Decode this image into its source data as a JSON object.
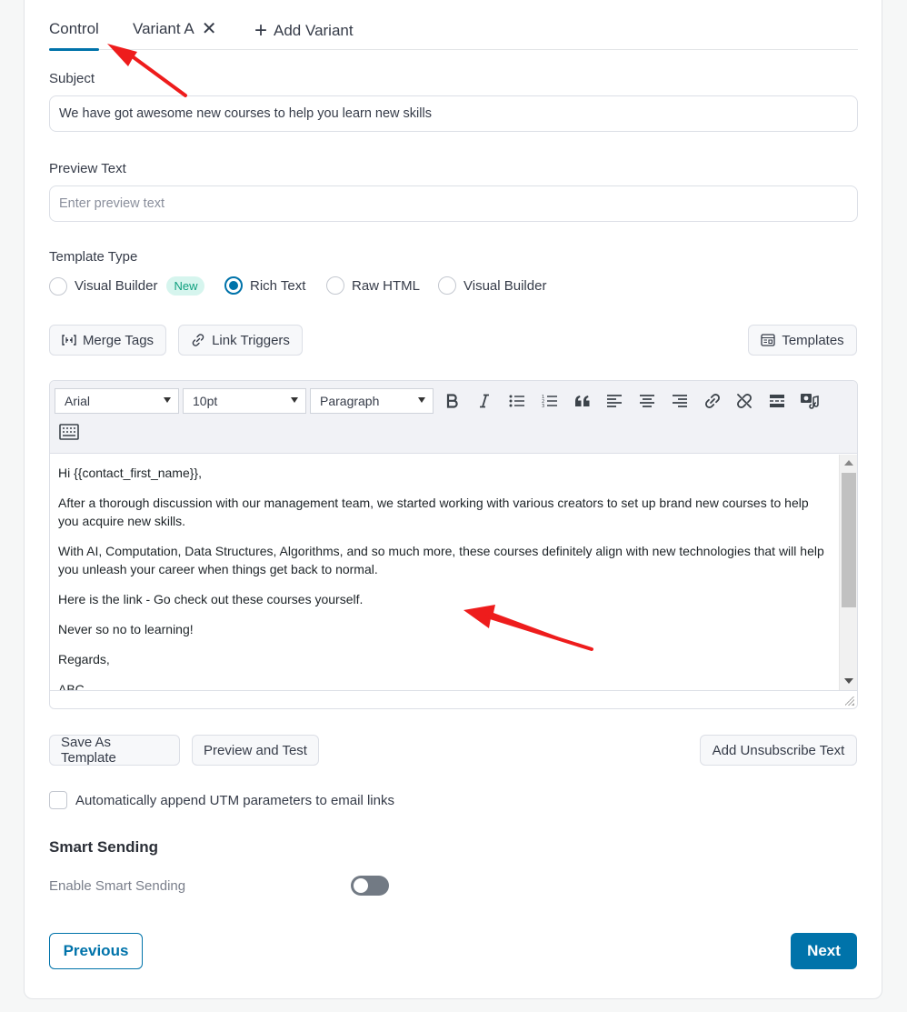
{
  "tabs": {
    "control": "Control",
    "variant_a": "Variant A",
    "add_variant": "Add Variant"
  },
  "subject": {
    "label": "Subject",
    "value": "We have got awesome new courses to help you learn new skills"
  },
  "preview_text": {
    "label": "Preview Text",
    "placeholder": "Enter preview text"
  },
  "template_type": {
    "label": "Template Type",
    "options": [
      "Visual Builder",
      "Rich Text",
      "Raw HTML",
      "Visual Builder"
    ],
    "new_badge": "New",
    "selected": "Rich Text"
  },
  "actions": {
    "merge_tags": "Merge Tags",
    "link_triggers": "Link Triggers",
    "templates": "Templates"
  },
  "editor": {
    "font_family": "Arial",
    "font_size": "10pt",
    "block_format": "Paragraph",
    "lines": [
      "Hi {{contact_first_name}},",
      "After a thorough discussion with our management team, we started working with various creators to set up brand new courses to help you acquire new skills.",
      "With AI, Computation, Data Structures, Algorithms, and so much more, these courses definitely align with new technologies that will help you unleash your career when things get back to normal.",
      "Here is the link - Go check out these courses yourself.",
      "Never so no to learning!",
      "Regards,",
      "ABC"
    ]
  },
  "bottom_actions": {
    "save_as_template": "Save As Template",
    "preview_and_test": "Preview and Test",
    "add_unsubscribe_text": "Add Unsubscribe Text"
  },
  "utm": {
    "label": "Automatically append UTM parameters to email links",
    "checked": false
  },
  "smart_sending": {
    "heading": "Smart Sending",
    "label": "Enable Smart Sending",
    "enabled": false
  },
  "nav": {
    "previous": "Previous",
    "next": "Next"
  },
  "colors": {
    "accent": "#0073aa",
    "annotation_arrow": "#ee1c1c",
    "badge_bg": "#d6f5ee",
    "badge_text": "#0e9f7e"
  }
}
